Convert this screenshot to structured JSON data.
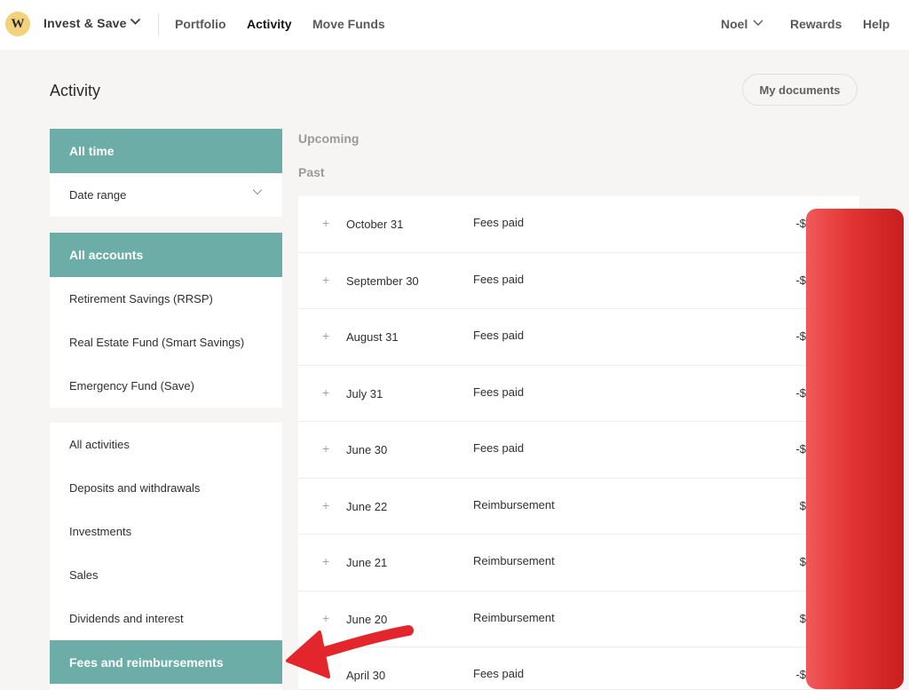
{
  "topnav": {
    "logo_letter": "W",
    "brand": "Invest & Save",
    "links": [
      "Portfolio",
      "Activity",
      "Move Funds"
    ],
    "active": "Activity",
    "user": "Noel",
    "rewards": "Rewards",
    "help": "Help"
  },
  "page": {
    "title": "Activity",
    "my_documents": "My documents"
  },
  "filters": {
    "time": {
      "selected": "All time",
      "date_range": "Date range"
    },
    "accounts": {
      "selected": "All accounts",
      "items": [
        "Retirement Savings (RRSP)",
        "Real Estate Fund (Smart Savings)",
        "Emergency Fund (Save)"
      ]
    },
    "activities": {
      "items": [
        "All activities",
        "Deposits and withdrawals",
        "Investments",
        "Sales",
        "Dividends and interest"
      ],
      "selected": "Fees and reimbursements"
    }
  },
  "sections": {
    "upcoming": "Upcoming",
    "past": "Past"
  },
  "transactions": [
    {
      "date": "October 31",
      "description": "Fees paid",
      "amount": "-$"
    },
    {
      "date": "September 30",
      "description": "Fees paid",
      "amount": "-$"
    },
    {
      "date": "August 31",
      "description": "Fees paid",
      "amount": "-$"
    },
    {
      "date": "July 31",
      "description": "Fees paid",
      "amount": "-$"
    },
    {
      "date": "June 30",
      "description": "Fees paid",
      "amount": "-$"
    },
    {
      "date": "June 22",
      "description": "Reimbursement",
      "amount": "$"
    },
    {
      "date": "June 21",
      "description": "Reimbursement",
      "amount": "$"
    },
    {
      "date": "June 20",
      "description": "Reimbursement",
      "amount": "$"
    },
    {
      "date": "April 30",
      "description": "Fees paid",
      "amount": "-$"
    }
  ],
  "expand_symbol": "+",
  "colors": {
    "accent": "#6dada7",
    "logo": "#f2d27c",
    "redaction": "#e33434",
    "arrow": "#e3262b"
  },
  "icons": {
    "dropdown": "chevron-down-icon",
    "expand": "plus-icon",
    "annotation": "arrow-left-icon"
  }
}
